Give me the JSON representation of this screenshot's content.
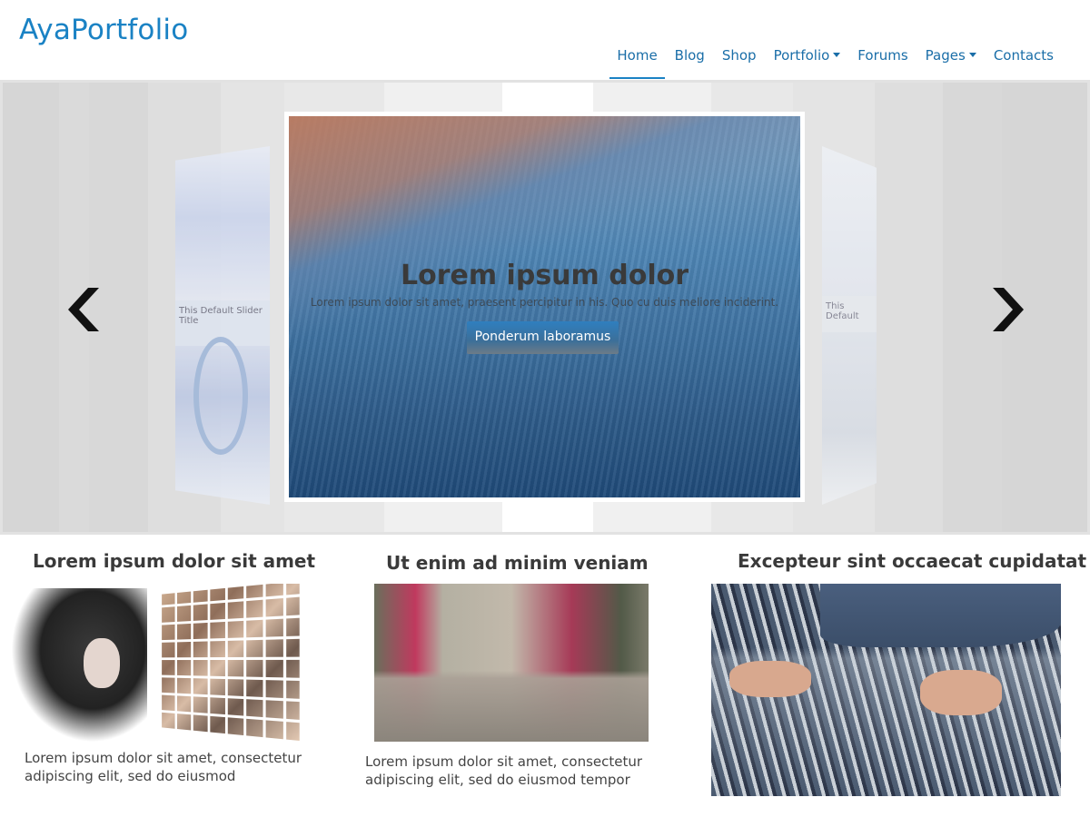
{
  "header": {
    "logo": "AyaPortfolio",
    "nav": [
      {
        "label": "Home",
        "active": true
      },
      {
        "label": "Blog"
      },
      {
        "label": "Shop"
      },
      {
        "label": "Portfolio",
        "dropdown": true
      },
      {
        "label": "Forums"
      },
      {
        "label": "Pages",
        "dropdown": true
      },
      {
        "label": "Contacts"
      }
    ]
  },
  "slider": {
    "title": "Lorem ipsum dolor",
    "text": "Lorem ipsum dolor sit amet, praesent percipitur in his. Quo cu duis meliore inciderint.",
    "button": "Ponderum laboramus",
    "left_card_text": "This Default Slider Title",
    "right_card_text": "This Default",
    "prev_icon": "chevron-left-icon",
    "next_icon": "chevron-right-icon"
  },
  "columns": [
    {
      "title": "Lorem ipsum dolor sit amet",
      "text": "Lorem ipsum dolor sit amet, consectetur adipiscing elit, sed do eiusmod"
    },
    {
      "title": "Ut enim ad minim veniam",
      "text": "Lorem ipsum dolor sit amet, consectetur adipiscing elit, sed do eiusmod tempor"
    },
    {
      "title": "Excepteur sint occaecat cupidatat",
      "text": ""
    }
  ],
  "colors": {
    "accent": "#1a82c4",
    "nav_text": "#1a6ea8"
  }
}
